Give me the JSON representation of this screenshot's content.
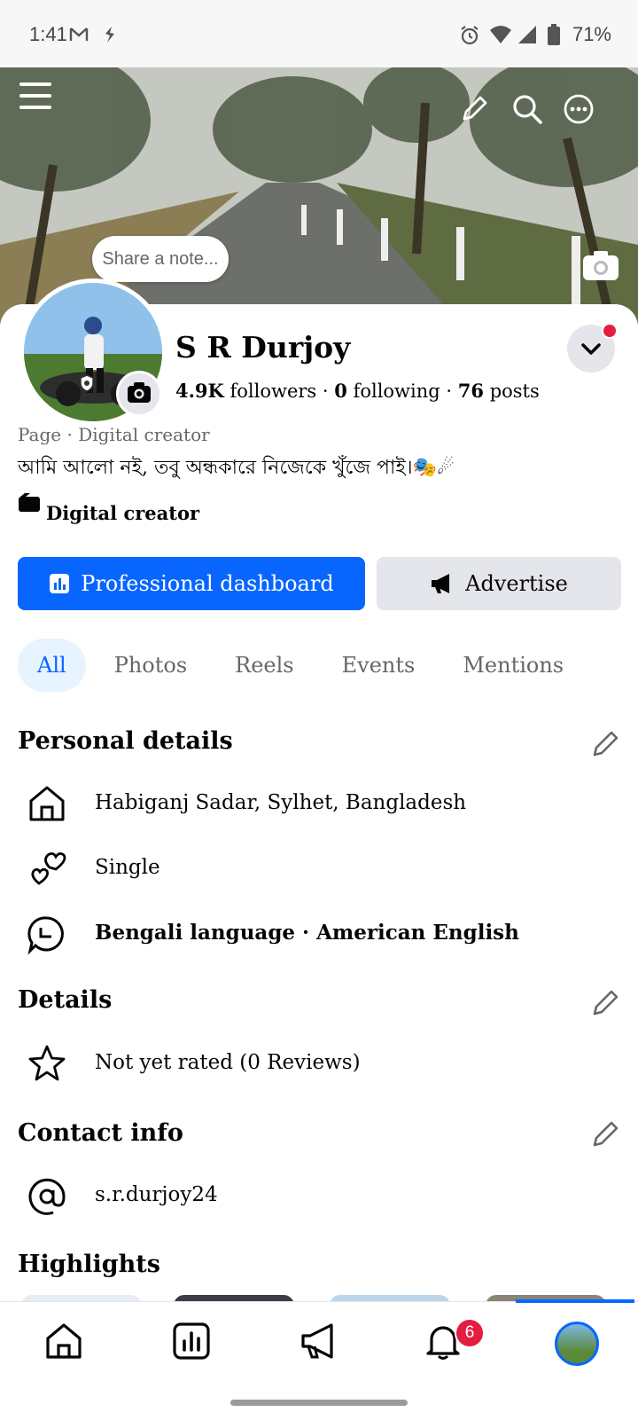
{
  "status": {
    "time": "1:41",
    "battery": "71%"
  },
  "cover": {
    "note": "Share a note..."
  },
  "profile": {
    "name": "S R Durjoy",
    "followers_count": "4.9K",
    "followers_label": "followers",
    "following_count": "0",
    "following_label": "following",
    "posts_count": "76",
    "posts_label": "posts",
    "category": "Page · Digital creator",
    "bio": "আমি আলো নই, তবু অন্ধকারে নিজেকে খুঁজে পাই।🎭☄",
    "creator_label": "Digital creator"
  },
  "actions": {
    "dashboard": "Professional dashboard",
    "advertise": "Advertise"
  },
  "tabs": [
    {
      "label": "All",
      "active": true
    },
    {
      "label": "Photos"
    },
    {
      "label": "Reels"
    },
    {
      "label": "Events"
    },
    {
      "label": "Mentions"
    }
  ],
  "personal_details": {
    "title": "Personal details",
    "location": "Habiganj Sadar, Sylhet, Bangladesh",
    "relationship": "Single",
    "languages": "Bengali language · American English"
  },
  "details": {
    "title": "Details",
    "rating": "Not yet rated (0 Reviews)"
  },
  "contact": {
    "title": "Contact info",
    "handle": "s.r.durjoy24"
  },
  "highlights": {
    "title": "Highlights"
  },
  "bottom_nav": {
    "notifications_badge": "6"
  },
  "colors": {
    "brand": "#0866ff",
    "badge": "#e41e3f",
    "secondary_bg": "#e4e6eb",
    "muted_text": "#65676b"
  }
}
